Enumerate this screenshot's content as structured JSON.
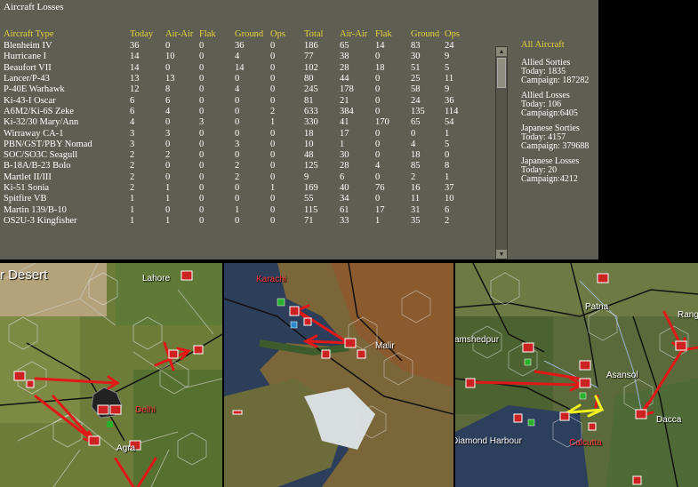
{
  "panel": {
    "title": "Aircraft Losses",
    "headers": [
      "Aircraft Type",
      "Today",
      "Air-Air",
      "Flak",
      "Ground",
      "Ops",
      "Total",
      "Air-Air",
      "Flak",
      "Ground",
      "Ops"
    ],
    "rows": [
      [
        "Blenheim IV",
        "36",
        "0",
        "0",
        "36",
        "0",
        "186",
        "65",
        "14",
        "83",
        "24"
      ],
      [
        "Hurricane I",
        "14",
        "10",
        "0",
        "4",
        "0",
        "77",
        "38",
        "0",
        "30",
        "9"
      ],
      [
        "Beaufort VII",
        "14",
        "0",
        "0",
        "14",
        "0",
        "102",
        "28",
        "18",
        "51",
        "5"
      ],
      [
        "Lancer/P-43",
        "13",
        "13",
        "0",
        "0",
        "0",
        "80",
        "44",
        "0",
        "25",
        "11"
      ],
      [
        "P-40E Warhawk",
        "12",
        "8",
        "0",
        "4",
        "0",
        "245",
        "178",
        "0",
        "58",
        "9"
      ],
      [
        "Ki-43-I Oscar",
        "6",
        "6",
        "0",
        "0",
        "0",
        "81",
        "21",
        "0",
        "24",
        "36"
      ],
      [
        "A6M2/Ki-6S Zeke",
        "6",
        "4",
        "0",
        "0",
        "2",
        "633",
        "384",
        "0",
        "135",
        "114"
      ],
      [
        "Ki-32/30 Mary/Ann",
        "4",
        "0",
        "3",
        "0",
        "1",
        "330",
        "41",
        "170",
        "65",
        "54"
      ],
      [
        "Wirraway CA-1",
        "3",
        "3",
        "0",
        "0",
        "0",
        "18",
        "17",
        "0",
        "0",
        "1"
      ],
      [
        "PBN/GST/PBY Nomad",
        "3",
        "0",
        "0",
        "3",
        "0",
        "10",
        "1",
        "0",
        "4",
        "5"
      ],
      [
        "SOC/SO3C Seagull",
        "2",
        "2",
        "0",
        "0",
        "0",
        "48",
        "30",
        "0",
        "18",
        "0"
      ],
      [
        "B-18A/B-23 Bolo",
        "2",
        "0",
        "0",
        "2",
        "0",
        "125",
        "28",
        "4",
        "85",
        "8"
      ],
      [
        "Martlet II/III",
        "2",
        "0",
        "0",
        "2",
        "0",
        "9",
        "6",
        "0",
        "2",
        "1"
      ],
      [
        "Ki-51 Sonia",
        "2",
        "1",
        "0",
        "0",
        "1",
        "169",
        "40",
        "76",
        "16",
        "37"
      ],
      [
        "Spitfire VB",
        "1",
        "1",
        "0",
        "0",
        "0",
        "55",
        "34",
        "0",
        "11",
        "10"
      ],
      [
        "Martin 139/B-10",
        "1",
        "0",
        "0",
        "1",
        "0",
        "115",
        "61",
        "17",
        "31",
        "6"
      ],
      [
        "OS2U-3 Kingfisher",
        "1",
        "1",
        "0",
        "0",
        "0",
        "71",
        "33",
        "1",
        "35",
        "2"
      ]
    ],
    "summary": {
      "heading": "All Aircraft",
      "blocks": [
        {
          "title": "Allied Sorties",
          "line1": "Today:   1835",
          "line2": "Campaign: 187282"
        },
        {
          "title": "Allied Losses",
          "line1": "Today:   106",
          "line2": "Campaign:6405"
        },
        {
          "title": "Japanese Sorties",
          "line1": "Today:   4157",
          "line2": "Campaign: 379688"
        },
        {
          "title": "Japanese Losses",
          "line1": "Today:   20",
          "line2": "Campaign:4212"
        }
      ]
    },
    "scroll": {
      "up_icon": "▲",
      "down_icon": "▼"
    }
  },
  "maps": {
    "map1": {
      "region_label": "r Desert",
      "city1": "Lahore",
      "city2": "Delhi",
      "city3": "Agra"
    },
    "map2": {
      "city1": "Karachi",
      "city2": "Malir"
    },
    "map3": {
      "city1": "Patna",
      "city2": "Jamshedpur",
      "city3": "Asansol",
      "city4": "Calcutta",
      "city5": "Diamond Harbour",
      "city6": "Dacca",
      "city7": "Rang"
    }
  },
  "colors": {
    "panel_bg": "#5f5e52",
    "header_yellow": "#e4d23a",
    "arrow_red": "#e01818",
    "arrow_yellow": "#f0f020"
  }
}
